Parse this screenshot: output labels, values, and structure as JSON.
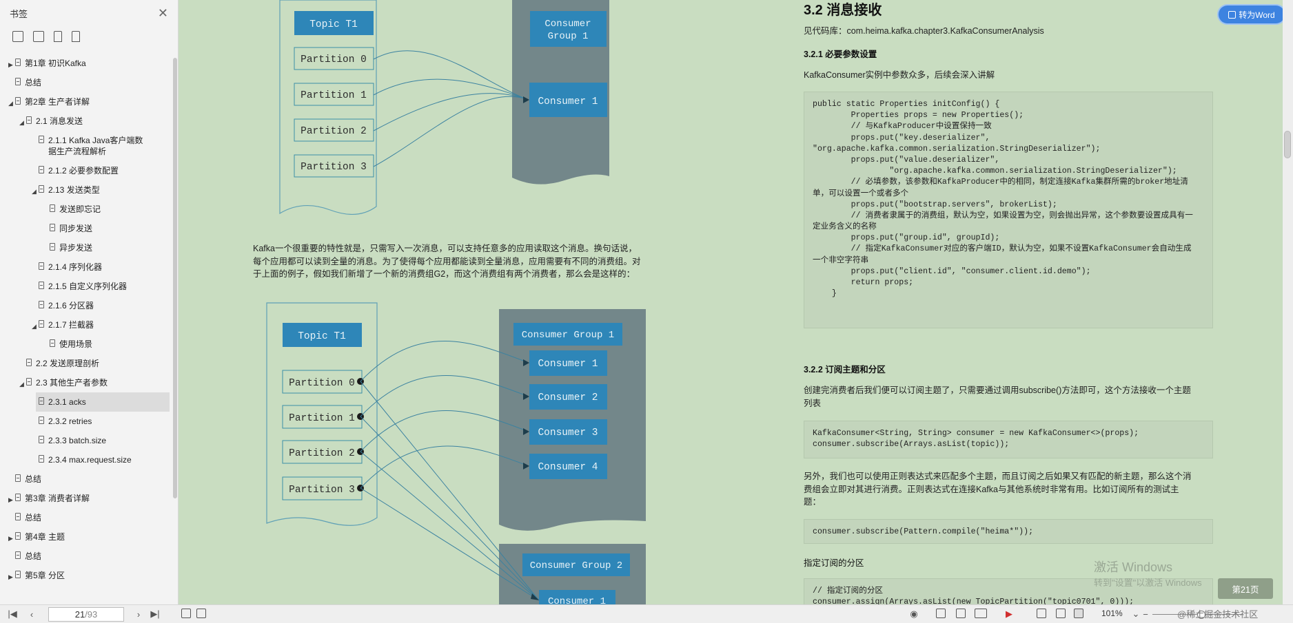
{
  "sidebar": {
    "title": "书签",
    "items": [
      {
        "label": "第1章 初识Kafka",
        "indent": 0,
        "arrow": "right"
      },
      {
        "label": "总结",
        "indent": 0,
        "arrow": ""
      },
      {
        "label": "第2章 生产者详解",
        "indent": 0,
        "arrow": "down"
      },
      {
        "label": "2.1 消息发送",
        "indent": 1,
        "arrow": "down"
      },
      {
        "label": "2.1.1 Kafka Java客户端数据生产流程解析",
        "indent": 2,
        "arrow": ""
      },
      {
        "label": "2.1.2 必要参数配置",
        "indent": 2,
        "arrow": ""
      },
      {
        "label": "2.13 发送类型",
        "indent": 2,
        "arrow": "down"
      },
      {
        "label": "发送即忘记",
        "indent": 3,
        "arrow": ""
      },
      {
        "label": "同步发送",
        "indent": 3,
        "arrow": ""
      },
      {
        "label": "异步发送",
        "indent": 3,
        "arrow": ""
      },
      {
        "label": "2.1.4 序列化器",
        "indent": 2,
        "arrow": ""
      },
      {
        "label": "2.1.5 自定义序列化器",
        "indent": 2,
        "arrow": ""
      },
      {
        "label": "2.1.6 分区器",
        "indent": 2,
        "arrow": ""
      },
      {
        "label": "2.1.7 拦截器",
        "indent": 2,
        "arrow": "down"
      },
      {
        "label": "使用场景",
        "indent": 3,
        "arrow": ""
      },
      {
        "label": "2.2 发送原理剖析",
        "indent": 1,
        "arrow": ""
      },
      {
        "label": "2.3 其他生产者参数",
        "indent": 1,
        "arrow": "down"
      },
      {
        "label": "2.3.1 acks",
        "indent": 2,
        "arrow": "",
        "selected": true
      },
      {
        "label": "2.3.2 retries",
        "indent": 2,
        "arrow": ""
      },
      {
        "label": "2.3.3 batch.size",
        "indent": 2,
        "arrow": ""
      },
      {
        "label": "2.3.4 max.request.size",
        "indent": 2,
        "arrow": ""
      },
      {
        "label": "总结",
        "indent": 0,
        "arrow": ""
      },
      {
        "label": "第3章 消费者详解",
        "indent": 0,
        "arrow": "right"
      },
      {
        "label": "总结",
        "indent": 0,
        "arrow": ""
      },
      {
        "label": "第4章  主题",
        "indent": 0,
        "arrow": "right"
      },
      {
        "label": "总结",
        "indent": 0,
        "arrow": ""
      },
      {
        "label": "第5章 分区",
        "indent": 0,
        "arrow": "right"
      }
    ]
  },
  "diagram1": {
    "topic": "Topic T1",
    "partitions": [
      "Partition 0",
      "Partition 1",
      "Partition 2",
      "Partition 3"
    ],
    "group": "Consumer\nGroup 1",
    "consumer": "Consumer 1"
  },
  "diagram2": {
    "topic": "Topic T1",
    "partitions": [
      "Partition 0",
      "Partition 1",
      "Partition 2",
      "Partition 3"
    ],
    "group1": "Consumer Group 1",
    "group1_consumers": [
      "Consumer 1",
      "Consumer 2",
      "Consumer 3",
      "Consumer 4"
    ],
    "group2": "Consumer Group 2",
    "group2_consumers": [
      "Consumer 1"
    ]
  },
  "left_paragraph": [
    "Kafka一个很重要的特性就是，只需写入一次消息，可以支持任意多的应用读取这个消息。换句话说，",
    "每个应用都可以读到全量的消息。为了使得每个应用都能读到全量消息，应用需要有不同的消费组。对",
    "于上面的例子，假如我们新增了一个新的消费组G2，而这个消费组有两个消费者，那么会是这样的："
  ],
  "right": {
    "h1": "3.2 消息接收",
    "code_repo": "见代码库：com.heima.kafka.chapter3.KafkaConsumerAnalysis",
    "h_321": "3.2.1 必要参数设置",
    "p_321": "KafkaConsumer实例中参数众多，后续会深入讲解",
    "code1": [
      "public static Properties initConfig() {",
      "        Properties props = new Properties();",
      "        // 与KafkaProducer中设置保持一致",
      "        props.put(\"key.deserializer\",",
      "\"org.apache.kafka.common.serialization.StringDeserializer\");",
      "        props.put(\"value.deserializer\",",
      "                \"org.apache.kafka.common.serialization.StringDeserializer\");",
      "        // 必填参数，该参数和KafkaProducer中的相同，制定连接Kafka集群所需的broker地址清",
      "单，可以设置一个或者多个",
      "        props.put(\"bootstrap.servers\", brokerList);",
      "        // 消费者隶属于的消费组，默认为空，如果设置为空，则会抛出异常，这个参数要设置成具有一",
      "定业务含义的名称",
      "        props.put(\"group.id\", groupId);",
      "        // 指定KafkaConsumer对应的客户端ID，默认为空，如果不设置KafkaConsumer会自动生成",
      "一个非空字符串",
      "        props.put(\"client.id\", \"consumer.client.id.demo\");",
      "        return props;",
      "    }"
    ],
    "h_322": "3.2.2 订阅主题和分区",
    "p_322": [
      "创建完消费者后我们便可以订阅主题了，只需要通过调用subscribe()方法即可，这个方法接收一个主题",
      "列表"
    ],
    "code2": [
      "KafkaConsumer<String, String> consumer = new KafkaConsumer<>(props);",
      "consumer.subscribe(Arrays.asList(topic));"
    ],
    "p_regex": [
      "另外，我们也可以使用正则表达式来匹配多个主题，而且订阅之后如果又有匹配的新主题，那么这个消",
      "费组会立即对其进行消费。正则表达式在连接Kafka与其他系统时非常有用。比如订阅所有的测试主",
      "题："
    ],
    "code3": [
      "consumer.subscribe(Pattern.compile(\"heima*\"));"
    ],
    "h_partition": "指定订阅的分区",
    "code4": [
      "// 指定订阅的分区",
      "consumer.assign(Arrays.asList(new TopicPartition(\"topic0701\", 0)));"
    ]
  },
  "word_button": "转为Word",
  "watermark": {
    "line1": "激活 Windows",
    "line2": "转到\"设置\"以激活 Windows"
  },
  "page_badge": "第21页",
  "bottom": {
    "page_current": "21",
    "page_total": "/93",
    "zoom": "101%",
    "brand": "@稀土掘金技术社区"
  },
  "colors": {
    "page_bg": "#c9ddc1",
    "box_blue": "#2e86b8",
    "group_bg": "#73878a",
    "partition_border": "#3c8fa8",
    "accent": "#3d83e0"
  }
}
